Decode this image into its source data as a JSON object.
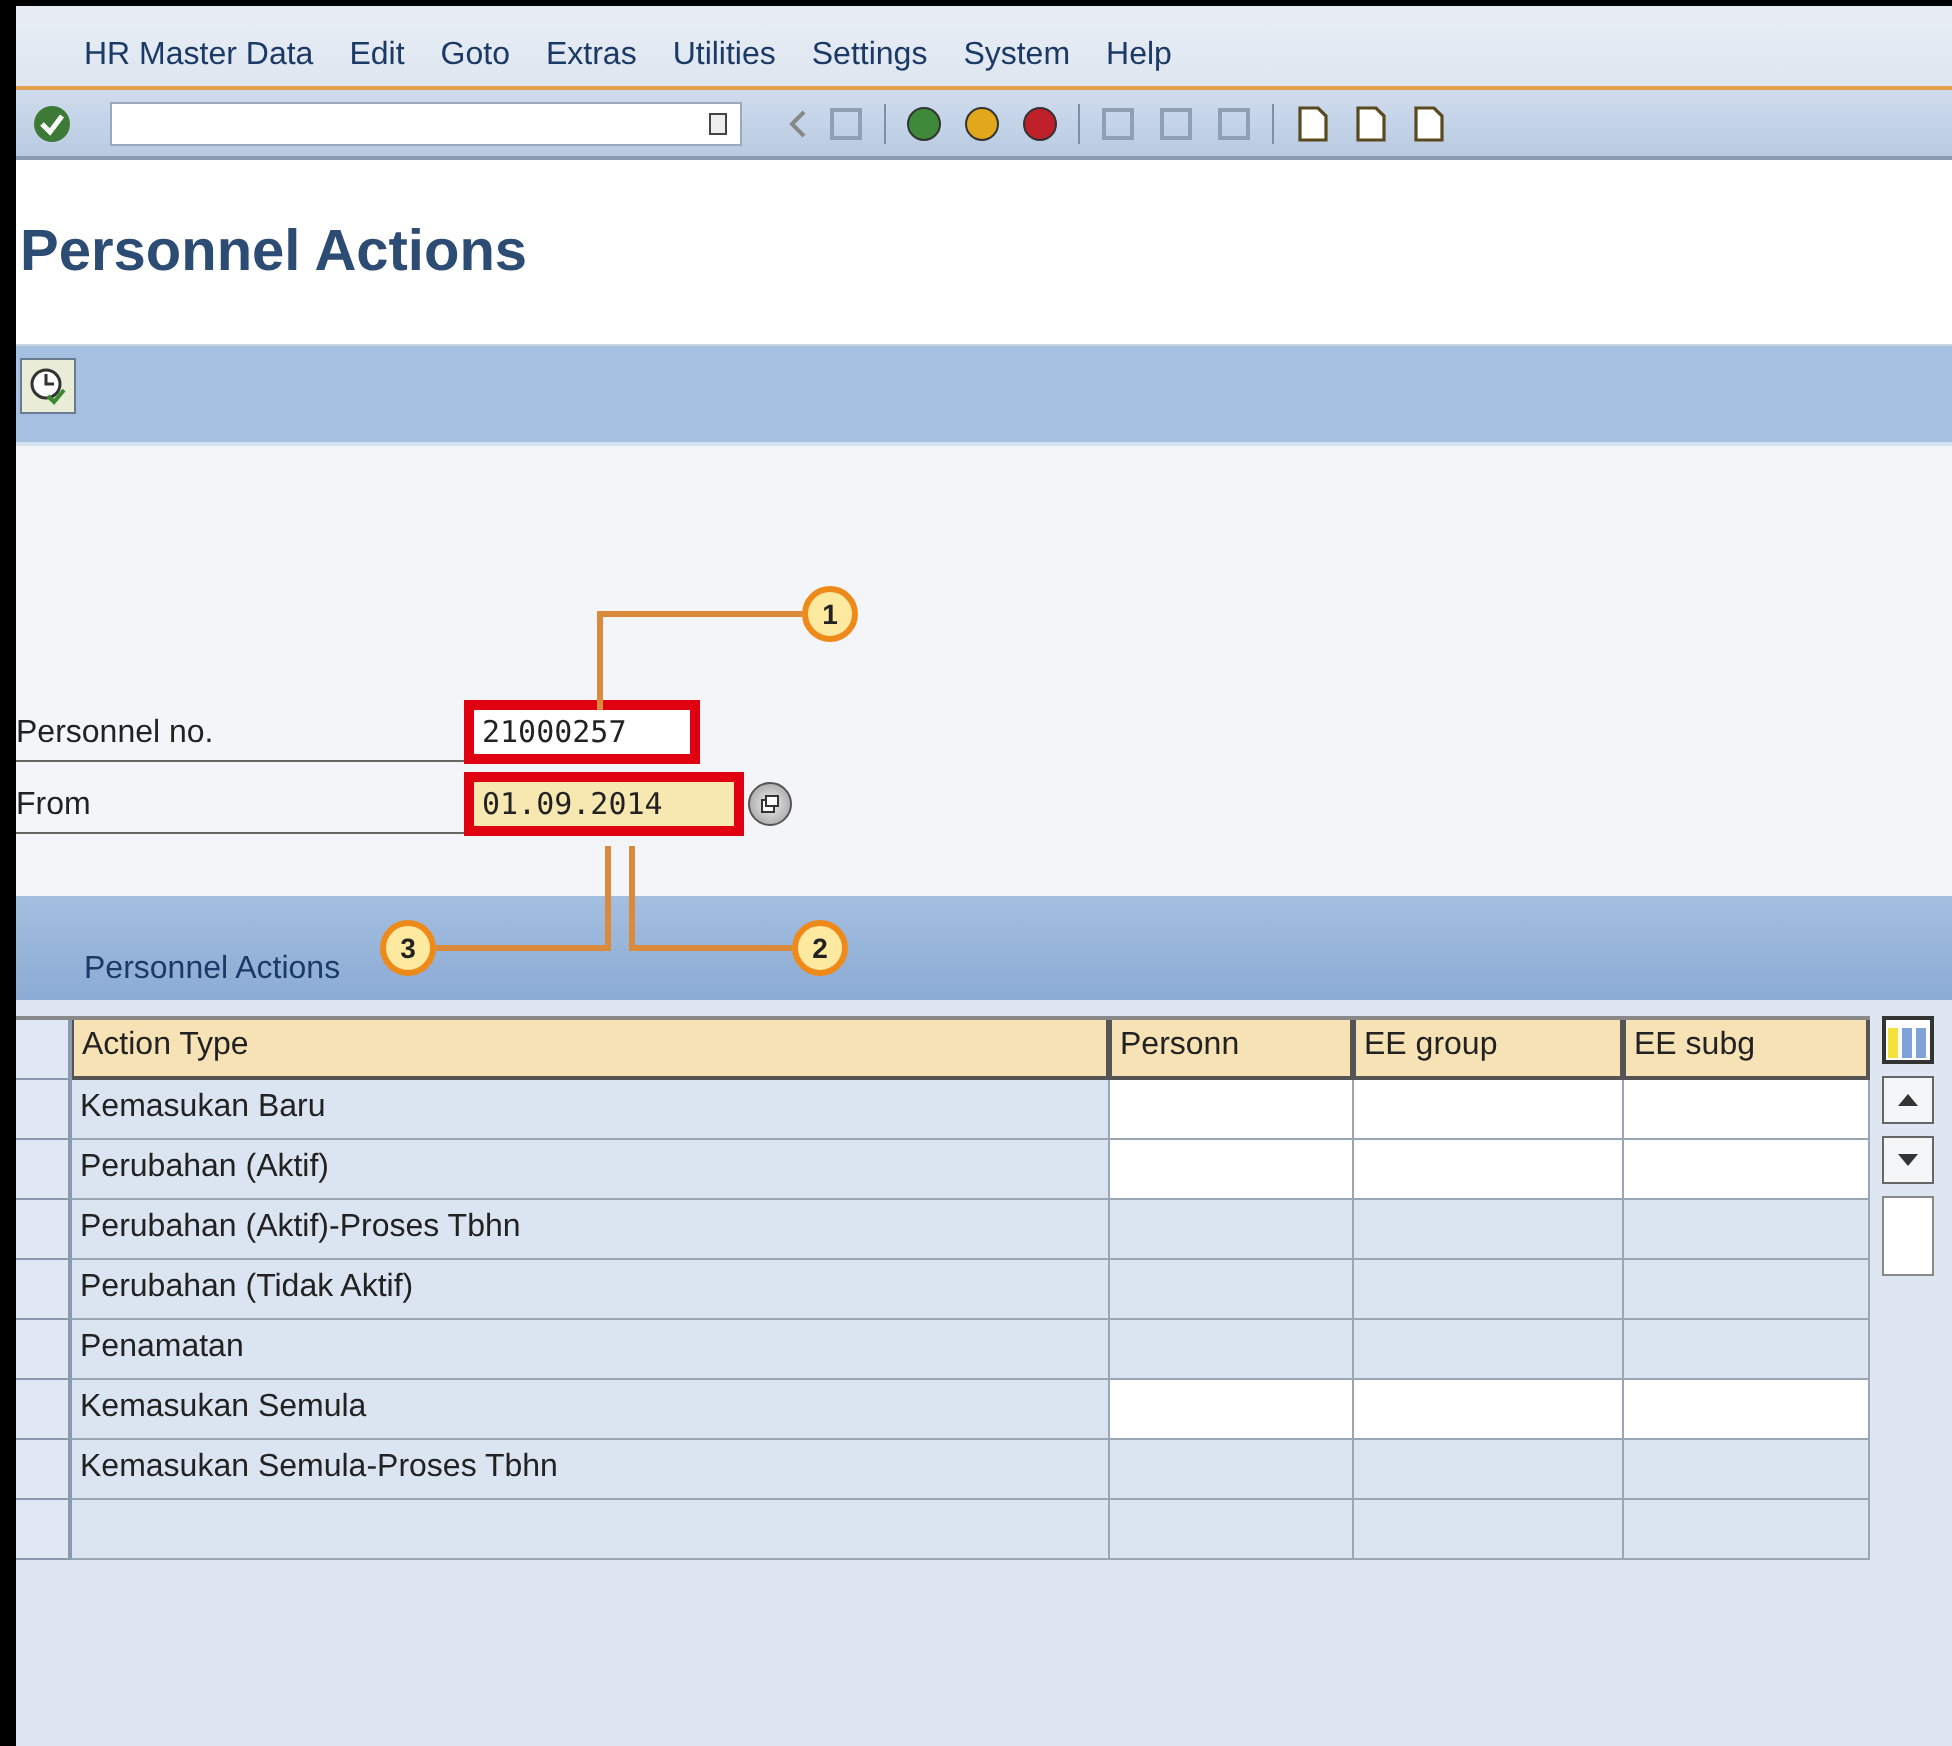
{
  "menu": [
    "HR Master Data",
    "Edit",
    "Goto",
    "Extras",
    "Utilities",
    "Settings",
    "System",
    "Help"
  ],
  "title": "Personnel Actions",
  "fields": [
    {
      "label": "Personnel no.",
      "value": "21000257",
      "highlighted": true,
      "kind": "plain"
    },
    {
      "label": "From",
      "value": "01.09.2014",
      "highlighted": true,
      "kind": "date"
    }
  ],
  "callouts": [
    {
      "label": "1"
    },
    {
      "label": "2"
    },
    {
      "label": "3"
    }
  ],
  "section_title": "Personnel Actions",
  "table": {
    "columns": [
      "Action Type",
      "Personn",
      "EE group",
      "EE subg"
    ],
    "rows": [
      {
        "action": "Kemasukan Baru",
        "editable": true
      },
      {
        "action": "Perubahan (Aktif)",
        "editable": true
      },
      {
        "action": "Perubahan (Aktif)-Proses Tbhn",
        "editable": false
      },
      {
        "action": "Perubahan (Tidak Aktif)",
        "editable": false
      },
      {
        "action": "Penamatan",
        "editable": false
      },
      {
        "action": "Kemasukan Semula",
        "editable": true
      },
      {
        "action": "Kemasukan Semula-Proses Tbhn",
        "editable": false
      }
    ]
  }
}
